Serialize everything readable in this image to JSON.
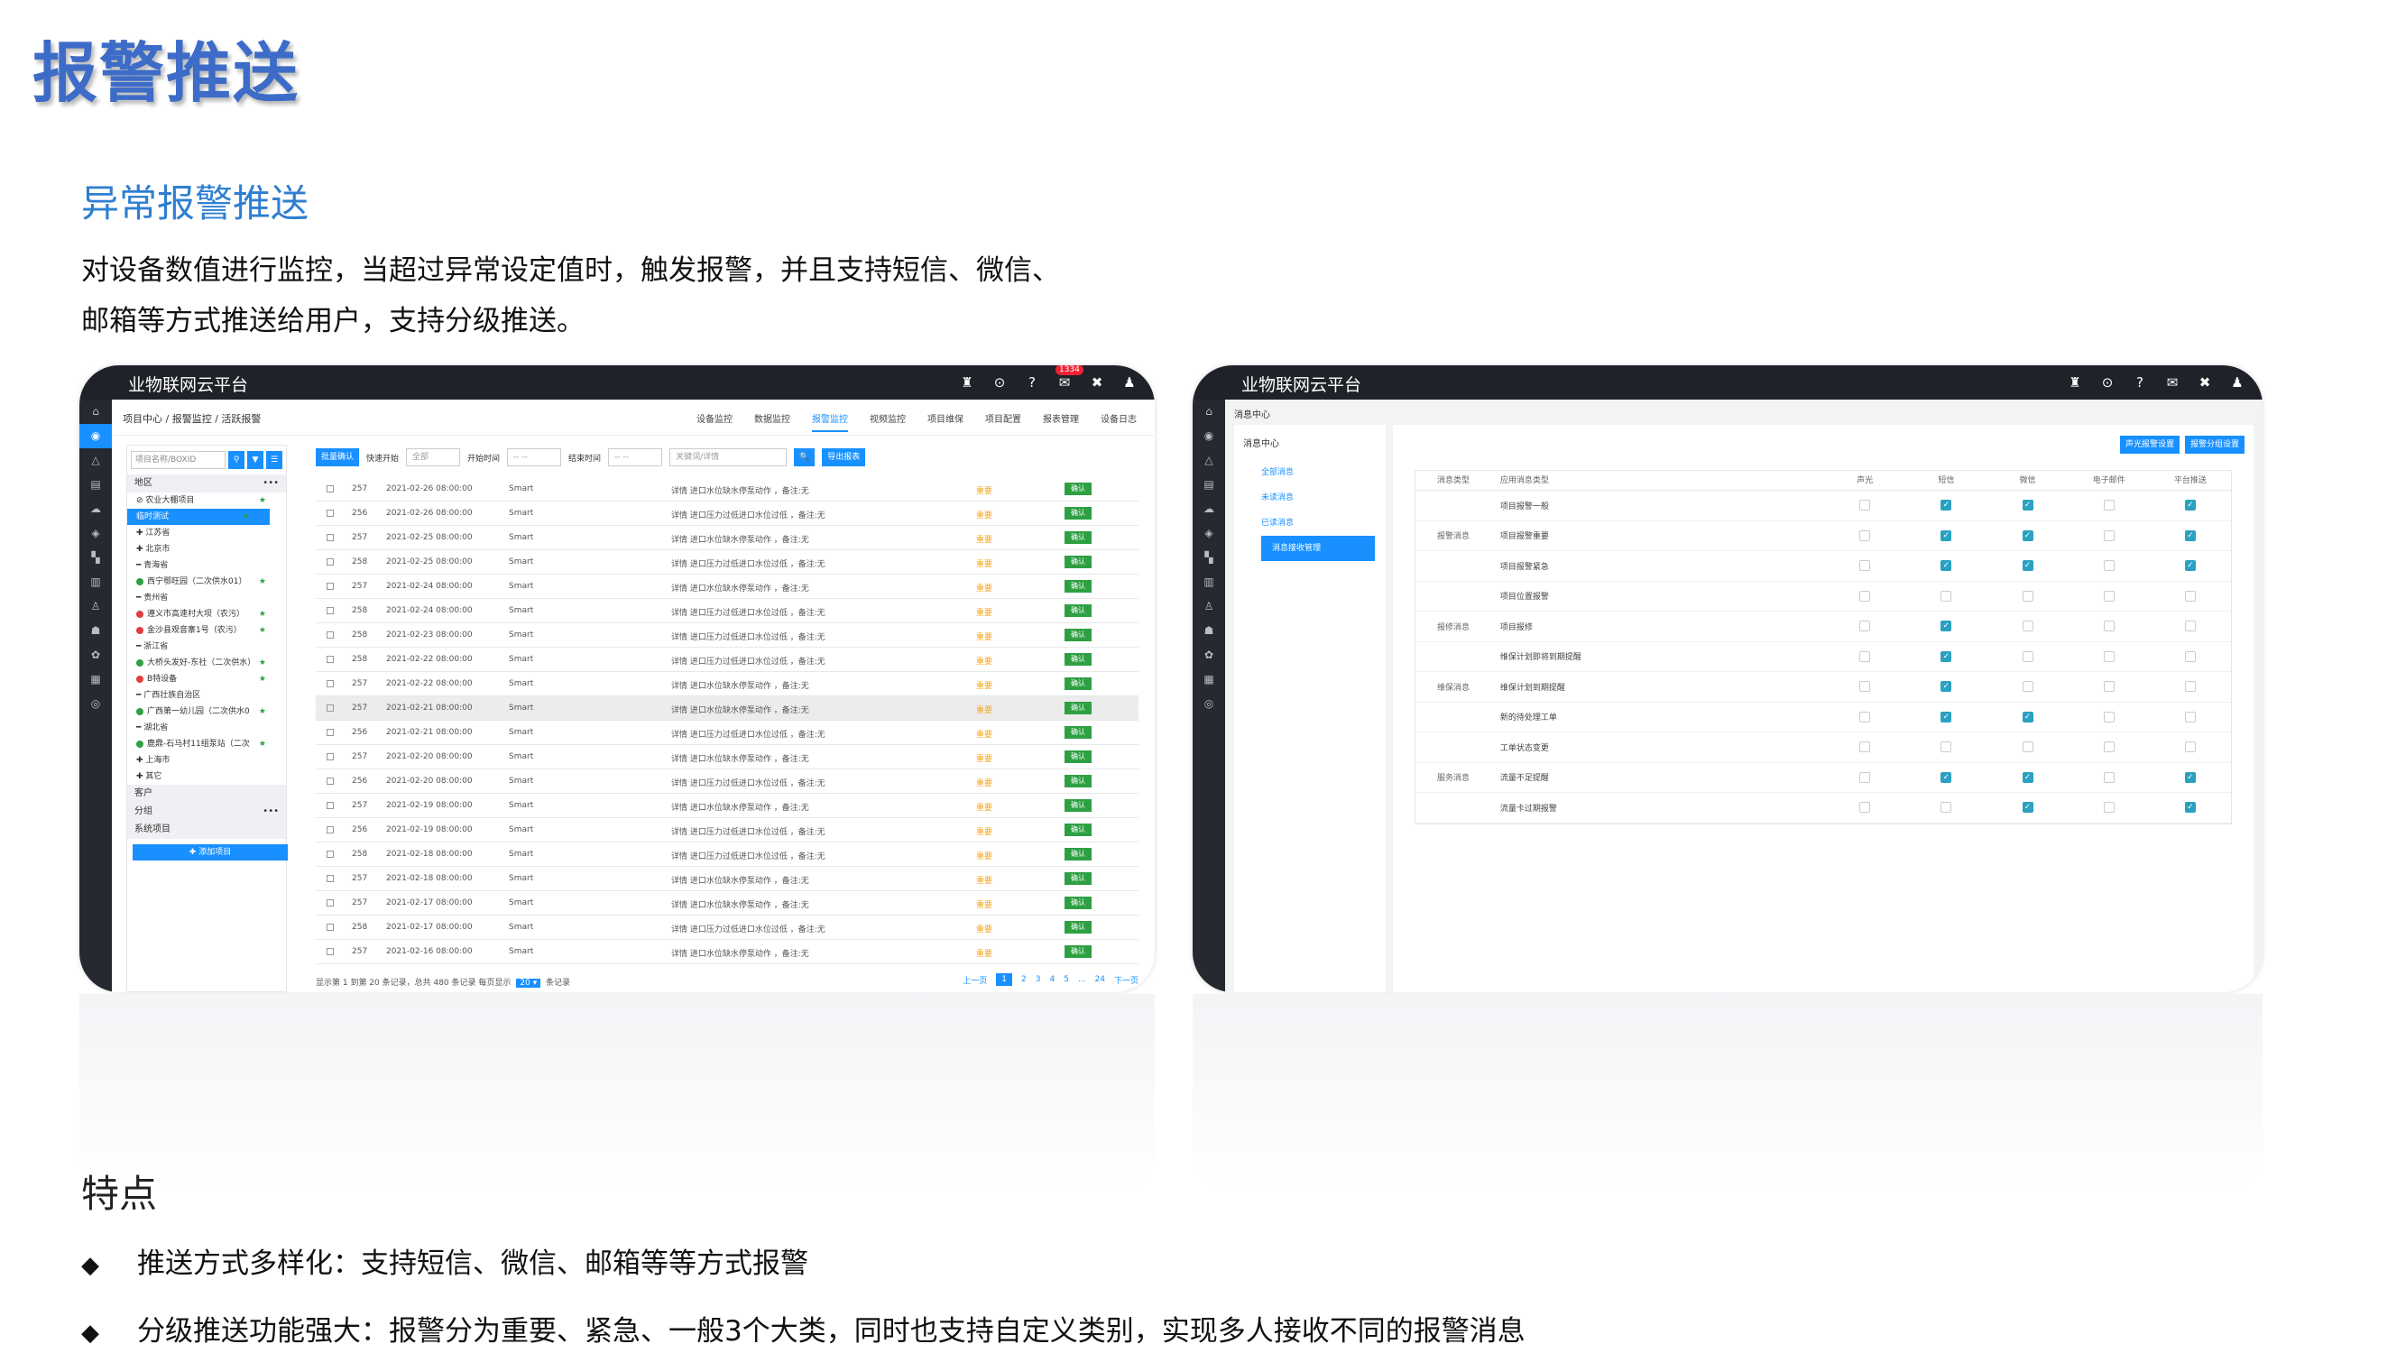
{
  "slide": {
    "title": "报警推送",
    "section_title": "异常报警推送",
    "desc_line1": "对设备数值进行监控，当超过异常设定值时，触发报警，并且支持短信、微信、",
    "desc_line2": "邮箱等方式推送给用户，支持分级推送。",
    "features_title": "特点",
    "bullets": [
      "推送方式多样化：支持短信、微信、邮箱等等方式报警",
      "分级推送功能强大：报警分为重要、紧急、一般3个大类，同时也支持自定义类别，实现多人接收不同的报警消息"
    ],
    "bullet_symbol": "◆"
  },
  "shot1": {
    "brand": "业物联网云平台",
    "badge": "1334",
    "breadcrumb": "项目中心 / 报警监控 / 活跃报警",
    "tabs": [
      "设备监控",
      "数据监控",
      "报警监控",
      "视频监控",
      "项目维保",
      "项目配置",
      "报表管理",
      "设备日志"
    ],
    "active_tab": "报警监控",
    "tree": {
      "search_placeholder": "项目名称/BOXID",
      "region_label": "地区",
      "nodes": [
        {
          "text": "⊘ 农业大棚项目",
          "star": "★"
        },
        {
          "text": "临时测试",
          "selected": true,
          "star": "★"
        },
        {
          "text": "✚ 江苏省"
        },
        {
          "text": "✚ 北京市"
        },
        {
          "text": "━ 青海省"
        },
        {
          "text": "西宁鄂旺园（二次供水01）",
          "dot": "green",
          "star": "★"
        },
        {
          "text": "━ 贵州省"
        },
        {
          "text": "遵义市高速村大坝（农污）",
          "dot": "red",
          "star": "★"
        },
        {
          "text": "金沙县观音寨1号（农污）",
          "dot": "red",
          "star": "★"
        },
        {
          "text": "━ 浙江省"
        },
        {
          "text": "大桥头发好-东社（二次供水）",
          "dot": "green",
          "star": "★"
        },
        {
          "text": "B特设备",
          "dot": "red",
          "star": "★"
        },
        {
          "text": "━ 广西壮族自治区"
        },
        {
          "text": "广西第一幼儿园（二次供水0",
          "dot": "green",
          "star": "★"
        },
        {
          "text": "━ 湖北省"
        },
        {
          "text": "鹿鼎-石马村11组泵站（二次",
          "dot": "green",
          "star": "★"
        },
        {
          "text": "✚ 上海市"
        },
        {
          "text": "✚ 其它"
        }
      ],
      "customer_label": "客户",
      "group_label": "分组",
      "system_label": "系统项目",
      "add_label": "✚ 添加项目",
      "more": "•••"
    },
    "toolbar": {
      "batch_confirm": "批量确认",
      "quick_start": "快速开始",
      "all": "全部",
      "start_time": "开始时间",
      "end_time": "结束时间",
      "time_placeholder": "-- --",
      "keyword_placeholder": "关键词/详情",
      "search": "🔍",
      "export": "导出报表"
    },
    "rows": [
      {
        "id": "257",
        "date": "2021-02-26 08:00:00",
        "type": "Smart",
        "detail": "详情  进口水位缺水停泵动作  ，备注:无",
        "level": "重要",
        "action": "确认"
      },
      {
        "id": "256",
        "date": "2021-02-26 08:00:00",
        "type": "Smart",
        "detail": "详情  进口压力过低进口水位过低  ，备注:无",
        "level": "重要",
        "action": "确认"
      },
      {
        "id": "257",
        "date": "2021-02-25 08:00:00",
        "type": "Smart",
        "detail": "详情  进口水位缺水停泵动作  ，备注:无",
        "level": "重要",
        "action": "确认"
      },
      {
        "id": "258",
        "date": "2021-02-25 08:00:00",
        "type": "Smart",
        "detail": "详情  进口压力过低进口水位过低  ，备注:无",
        "level": "重要",
        "action": "确认"
      },
      {
        "id": "257",
        "date": "2021-02-24 08:00:00",
        "type": "Smart",
        "detail": "详情  进口水位缺水停泵动作  ，备注:无",
        "level": "重要",
        "action": "确认"
      },
      {
        "id": "258",
        "date": "2021-02-24 08:00:00",
        "type": "Smart",
        "detail": "详情  进口压力过低进口水位过低  ，备注:无",
        "level": "重要",
        "action": "确认"
      },
      {
        "id": "258",
        "date": "2021-02-23 08:00:00",
        "type": "Smart",
        "detail": "详情  进口压力过低进口水位过低  ，备注:无",
        "level": "重要",
        "action": "确认"
      },
      {
        "id": "258",
        "date": "2021-02-22 08:00:00",
        "type": "Smart",
        "detail": "详情  进口压力过低进口水位过低  ，备注:无",
        "level": "重要",
        "action": "确认"
      },
      {
        "id": "257",
        "date": "2021-02-22 08:00:00",
        "type": "Smart",
        "detail": "详情  进口水位缺水停泵动作  ，备注:无",
        "level": "重要",
        "action": "确认"
      },
      {
        "id": "257",
        "date": "2021-02-21 08:00:00",
        "type": "Smart",
        "detail": "详情  进口水位缺水停泵动作  ，备注:无",
        "level": "重要",
        "action": "确认",
        "hl": true
      },
      {
        "id": "256",
        "date": "2021-02-21 08:00:00",
        "type": "Smart",
        "detail": "详情  进口压力过低进口水位过低  ，备注:无",
        "level": "重要",
        "action": "确认"
      },
      {
        "id": "257",
        "date": "2021-02-20 08:00:00",
        "type": "Smart",
        "detail": "详情  进口水位缺水停泵动作  ，备注:无",
        "level": "重要",
        "action": "确认"
      },
      {
        "id": "256",
        "date": "2021-02-20 08:00:00",
        "type": "Smart",
        "detail": "详情  进口压力过低进口水位过低  ，备注:无",
        "level": "重要",
        "action": "确认"
      },
      {
        "id": "257",
        "date": "2021-02-19 08:00:00",
        "type": "Smart",
        "detail": "详情  进口水位缺水停泵动作  ，备注:无",
        "level": "重要",
        "action": "确认"
      },
      {
        "id": "256",
        "date": "2021-02-19 08:00:00",
        "type": "Smart",
        "detail": "详情  进口压力过低进口水位过低  ，备注:无",
        "level": "重要",
        "action": "确认"
      },
      {
        "id": "258",
        "date": "2021-02-18 08:00:00",
        "type": "Smart",
        "detail": "详情  进口压力过低进口水位过低  ，备注:无",
        "level": "重要",
        "action": "确认"
      },
      {
        "id": "257",
        "date": "2021-02-18 08:00:00",
        "type": "Smart",
        "detail": "详情  进口水位缺水停泵动作  ，备注:无",
        "level": "重要",
        "action": "确认"
      },
      {
        "id": "257",
        "date": "2021-02-17 08:00:00",
        "type": "Smart",
        "detail": "详情  进口水位缺水停泵动作  ，备注:无",
        "level": "重要",
        "action": "确认"
      },
      {
        "id": "258",
        "date": "2021-02-17 08:00:00",
        "type": "Smart",
        "detail": "详情  进口压力过低进口水位过低  ，备注:无",
        "level": "重要",
        "action": "确认"
      },
      {
        "id": "257",
        "date": "2021-02-16 08:00:00",
        "type": "Smart",
        "detail": "详情  进口水位缺水停泵动作  ，备注:无",
        "level": "重要",
        "action": "确认"
      }
    ],
    "pager": {
      "summary_prefix": "显示第 1 到第 20 条记录，总共 480 条记录 每页显示",
      "page_size": "20 ▾",
      "summary_suffix": "条记录",
      "prev": "上一页",
      "pages": [
        "1",
        "2",
        "3",
        "4",
        "5",
        "...",
        "24"
      ],
      "next": "下一页"
    }
  },
  "shot2": {
    "brand": "业物联网云平台",
    "title": "消息中心",
    "side_head": "消息中心",
    "side_items": [
      "全部消息",
      "未读消息",
      "已读消息",
      "消息接收管理"
    ],
    "btn_sound": "声光报警设置",
    "btn_time": "报警分组设置",
    "headers": [
      "消息类型",
      "应用消息类型",
      "声光",
      "短信",
      "微信",
      "电子邮件",
      "平台推送"
    ],
    "rows": [
      {
        "group": "",
        "name": "项目报警一般",
        "checks": [
          false,
          true,
          true,
          false,
          true
        ]
      },
      {
        "group": "报警消息",
        "name": "项目报警重要",
        "checks": [
          false,
          true,
          true,
          false,
          true
        ]
      },
      {
        "group": "",
        "name": "项目报警紧急",
        "checks": [
          false,
          true,
          true,
          false,
          true
        ]
      },
      {
        "group": "",
        "name": "项目位置报警",
        "checks": [
          false,
          false,
          false,
          false,
          false
        ]
      },
      {
        "group": "报修消息",
        "name": "项目报修",
        "checks": [
          false,
          true,
          false,
          false,
          false
        ]
      },
      {
        "group": "",
        "name": "维保计划即将到期提醒",
        "checks": [
          false,
          true,
          false,
          false,
          false
        ]
      },
      {
        "group": "维保消息",
        "name": "维保计划到期提醒",
        "checks": [
          false,
          true,
          false,
          false,
          false
        ]
      },
      {
        "group": "",
        "name": "新的待处理工单",
        "checks": [
          false,
          true,
          true,
          false,
          false
        ]
      },
      {
        "group": "",
        "name": "工单状态变更",
        "checks": [
          false,
          false,
          false,
          false,
          false
        ]
      },
      {
        "group": "服务消息",
        "name": "流量不足提醒",
        "checks": [
          false,
          true,
          true,
          false,
          true
        ]
      },
      {
        "group": "",
        "name": "流量卡过期报警",
        "checks": [
          false,
          false,
          true,
          false,
          true
        ]
      }
    ]
  },
  "icons": {
    "leftnav": [
      "home-icon",
      "cube-icon",
      "bell-icon",
      "doc-icon",
      "cloud-icon",
      "box-icon",
      "chart-icon",
      "doc-icon",
      "user-icon",
      "alarm-icon",
      "gear-icon",
      "doc-icon",
      "db-icon"
    ],
    "topbar": [
      "bell-icon",
      "settings-icon",
      "help-icon",
      "mail-icon",
      "fullscreen-icon",
      "user-icon"
    ]
  },
  "colors": {
    "title": "#3d6cc8",
    "section": "#2f7fd1",
    "accent": "#1890ff",
    "ok": "#2ea043",
    "warn": "#f5a623",
    "topbar": "#1f2228"
  }
}
